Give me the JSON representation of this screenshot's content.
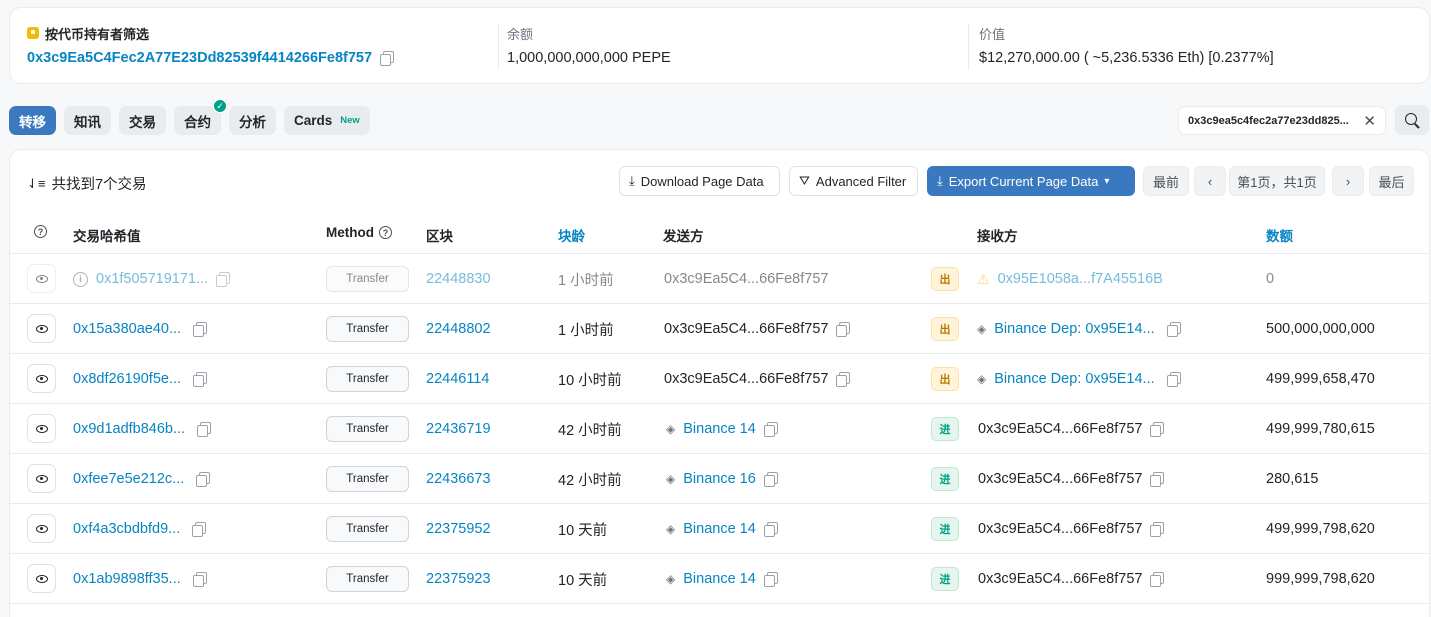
{
  "summary": {
    "holder_label": "按代币持有者筛选",
    "holder_address": "0x3c9Ea5C4Fec2A77E23Dd82539f4414266Fe8f757",
    "balance_label": "余额",
    "balance_value": "1,000,000,000,000 PEPE",
    "value_label": "价值",
    "value_value": "$12,270,000.00 ( ~5,236.5336 Eth) [0.2377%]"
  },
  "tabs": [
    {
      "label": "转移",
      "active": true
    },
    {
      "label": "知讯"
    },
    {
      "label": "交易"
    },
    {
      "label": "合约",
      "verified": true
    },
    {
      "label": "分析"
    },
    {
      "label": "Cards",
      "badge": "New"
    }
  ],
  "filter": {
    "address": "0x3c9ea5c4fec2a77e23dd825..."
  },
  "toolbar": {
    "found_text": "共找到7个交易",
    "download_label": "Download Page Data",
    "advanced_filter_label": "Advanced Filter",
    "export_label": "Export Current Page Data",
    "first_label": "最前",
    "page_label": "第1页，共1页",
    "last_label": "最后"
  },
  "table": {
    "headers": {
      "hash": "交易哈希值",
      "method": "Method",
      "block": "区块",
      "age": "块龄",
      "from": "发送方",
      "to": "接收方",
      "amount": "数额"
    },
    "rows": [
      {
        "hash": "0x1f505719171...",
        "method": "Transfer",
        "block": "22448830",
        "age": "1 小时前",
        "from": "0x3c9Ea5C4...66Fe8f757",
        "dir": "出",
        "to": "0x95E1058a...f7A45516B",
        "amount": "0"
      },
      {
        "hash": "0x15a380ae40...",
        "method": "Transfer",
        "block": "22448802",
        "age": "1 小时前",
        "from": "0x3c9Ea5C4...66Fe8f757",
        "dir": "出",
        "to": "Binance Dep: 0x95E14...",
        "amount": "500,000,000,000"
      },
      {
        "hash": "0x8df26190f5e...",
        "method": "Transfer",
        "block": "22446114",
        "age": "10 小时前",
        "from": "0x3c9Ea5C4...66Fe8f757",
        "dir": "出",
        "to": "Binance Dep: 0x95E14...",
        "amount": "499,999,658,470"
      },
      {
        "hash": "0x9d1adfb846b...",
        "method": "Transfer",
        "block": "22436719",
        "age": "42 小时前",
        "from": "Binance 14",
        "dir": "进",
        "to": "0x3c9Ea5C4...66Fe8f757",
        "amount": "499,999,780,615"
      },
      {
        "hash": "0xfee7e5e212c...",
        "method": "Transfer",
        "block": "22436673",
        "age": "42 小时前",
        "from": "Binance 16",
        "dir": "进",
        "to": "0x3c9Ea5C4...66Fe8f757",
        "amount": "280,615"
      },
      {
        "hash": "0xf4a3cbdbfd9...",
        "method": "Transfer",
        "block": "22375952",
        "age": "10 天前",
        "from": "Binance 14",
        "dir": "进",
        "to": "0x3c9Ea5C4...66Fe8f757",
        "amount": "499,999,798,620"
      },
      {
        "hash": "0x1ab9898ff35...",
        "method": "Transfer",
        "block": "22375923",
        "age": "10 天前",
        "from": "Binance 14",
        "dir": "进",
        "to": "0x3c9Ea5C4...66Fe8f757",
        "amount": "999,999,798,620"
      }
    ]
  },
  "colors": {
    "link": "#0784c3",
    "primary": "#3a79bf",
    "out_badge": "#fff4d9",
    "in_badge": "#e6f6ef"
  }
}
